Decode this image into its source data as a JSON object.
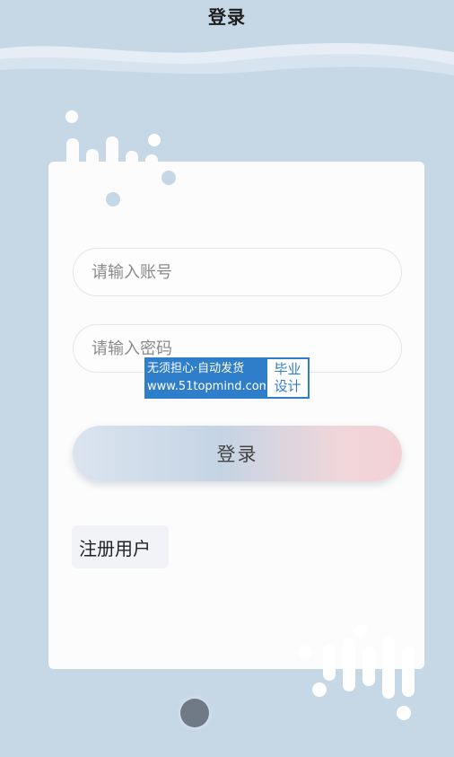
{
  "header": {
    "title": "登录"
  },
  "form": {
    "account_placeholder": "请输入账号",
    "password_placeholder": "请输入密码",
    "login_label": "登录",
    "register_label": "注册用户"
  },
  "watermark": {
    "line1": "无须担心·自动发货",
    "line2": "www.51topmind.com",
    "tag_line1": "毕业",
    "tag_line2": "设计"
  },
  "colors": {
    "background": "#c6d7e6",
    "card": "#fcfcfc",
    "watermark_blue": "#2f7ec9"
  }
}
